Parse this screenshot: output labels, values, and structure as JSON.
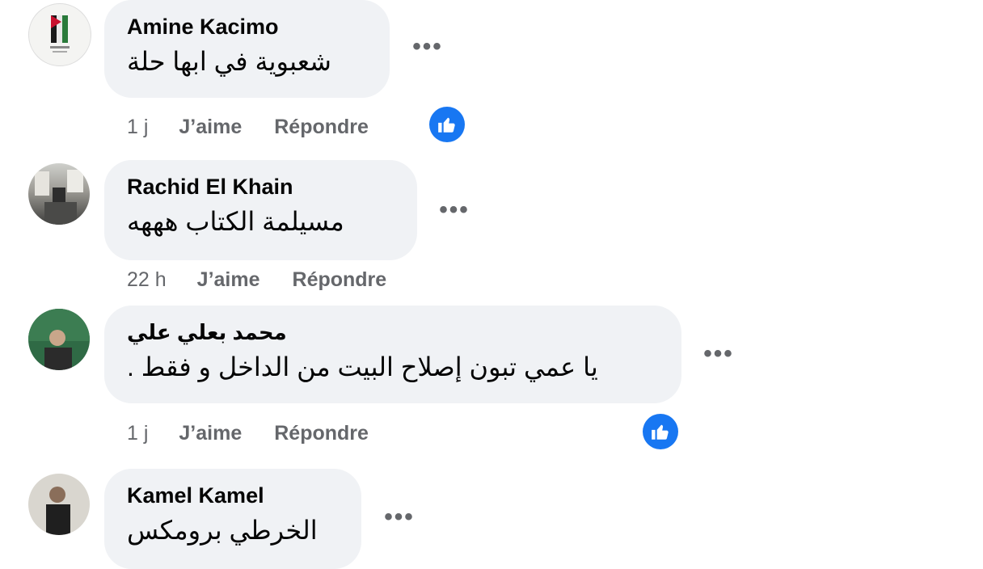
{
  "comments": [
    {
      "author": "Amine Kacimo",
      "text": "شعبوية في ابها حلة",
      "time": "1 j",
      "like": "J’aime",
      "reply": "Répondre",
      "has_reaction": true
    },
    {
      "author": "Rachid El Khain",
      "text": "مسيلمة الكتاب هههه",
      "time": "22 h",
      "like": "J’aime",
      "reply": "Répondre",
      "has_reaction": false
    },
    {
      "author": "محمد بعلي علي",
      "text": "يا عمي تبون إصلاح البيت من الداخل و فقط .",
      "time": "1 j",
      "like": "J’aime",
      "reply": "Répondre",
      "has_reaction": true
    },
    {
      "author": "Kamel Kamel",
      "text": "الخرطي برومكس",
      "time": "",
      "like": "",
      "reply": "",
      "has_reaction": false
    }
  ],
  "more_icon": "more-options-icon",
  "reaction_icon": "like-thumb-icon",
  "colors": {
    "bubble": "#f0f2f5",
    "meta": "#65676b",
    "like_blue": "#1877f2"
  }
}
